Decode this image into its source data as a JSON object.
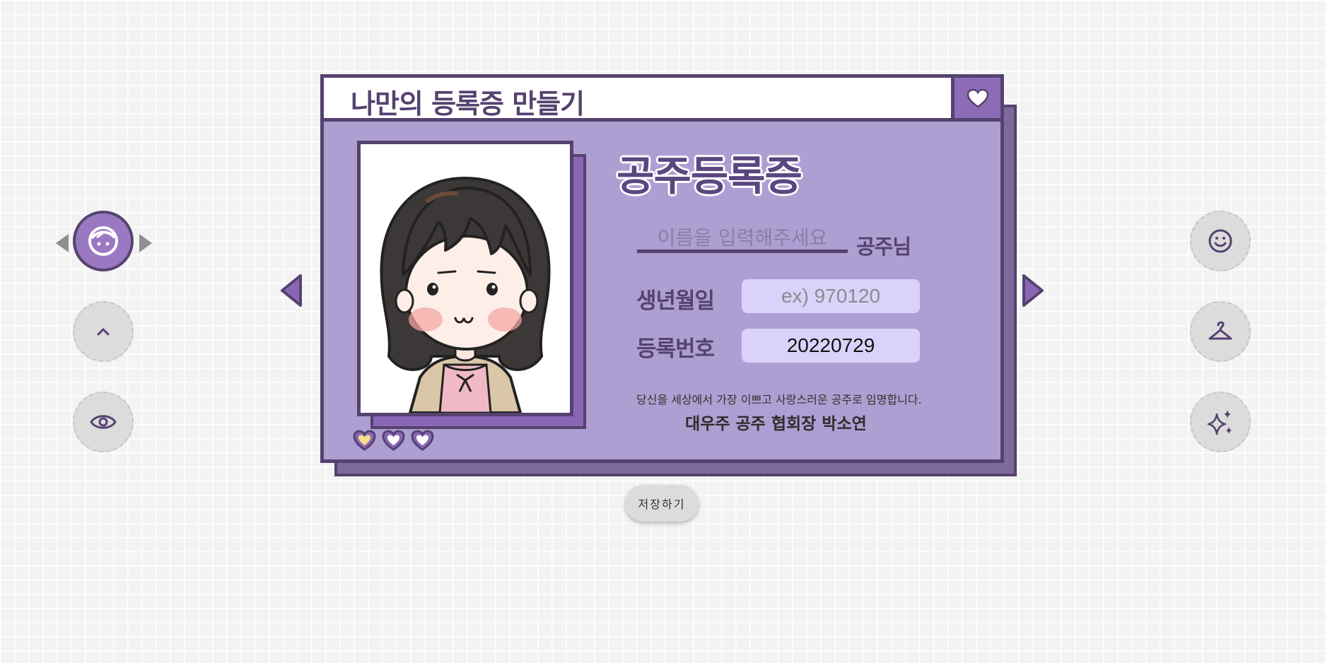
{
  "card": {
    "title": "나만의 등록증 만들기",
    "heading": "공주등록증",
    "name_placeholder": "이름을 입력해주세요",
    "name_suffix": "공주님",
    "birth_label": "생년월일",
    "birth_placeholder": "ex) 970120",
    "reg_label": "등록번호",
    "reg_value": "20220729",
    "statement": "당신을 세상에서 가장 이쁘고 사랑스러운 공주로 임명합니다.",
    "signature": "대우주 공주 협회장 박소연"
  },
  "buttons": {
    "save_label": "저장하기"
  },
  "left_tools": [
    "face-icon",
    "chevron-up-icon",
    "eye-icon"
  ],
  "right_tools": [
    "smiley-icon",
    "hanger-icon",
    "sparkle-icon"
  ],
  "hearts": [
    {
      "icon": "heart-icon",
      "color": "#f5df8a"
    },
    {
      "icon": "heart-icon",
      "color": "#ffffff"
    },
    {
      "icon": "heart-icon",
      "color": "#ffffff"
    }
  ],
  "colors": {
    "primary": "#55426f",
    "card_bg": "#ad9fd1",
    "accent": "#9a78c2",
    "field_bg": "#dad2fb"
  }
}
